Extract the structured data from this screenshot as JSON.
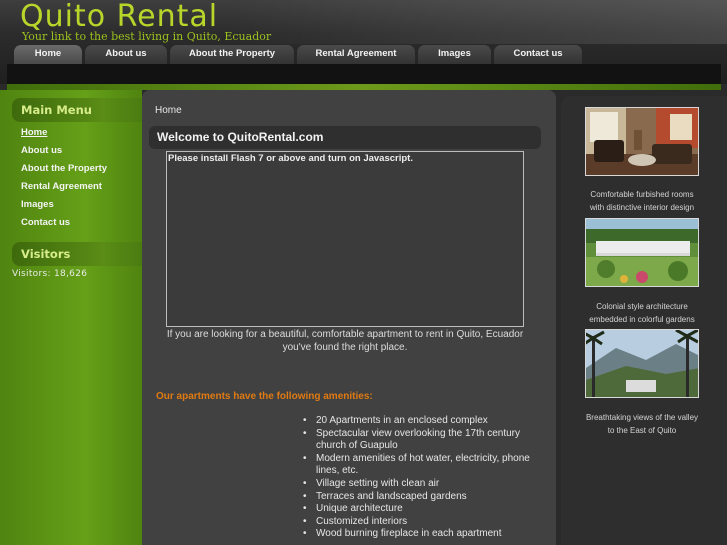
{
  "site": {
    "title": "Quito Rental",
    "tagline": "Your link to the best living in Quito, Ecuador"
  },
  "nav": {
    "tabs": [
      {
        "label": "Home",
        "active": true
      },
      {
        "label": "About us"
      },
      {
        "label": "About the Property"
      },
      {
        "label": "Rental Agreement"
      },
      {
        "label": "Images"
      },
      {
        "label": "Contact us"
      }
    ]
  },
  "sidebar": {
    "main_menu_heading": "Main Menu",
    "items": [
      {
        "label": "Home",
        "active": true
      },
      {
        "label": "About us"
      },
      {
        "label": "About the Property"
      },
      {
        "label": "Rental Agreement"
      },
      {
        "label": "Images"
      },
      {
        "label": "Contact us"
      }
    ],
    "visitors_heading": "Visitors",
    "visitors_text": "Visitors: 18,626"
  },
  "main": {
    "breadcrumb": "Home",
    "page_title": "Welcome to QuitoRental.com",
    "flash_message": "Please install Flash 7 or above and turn on Javascript.",
    "intro_line1": "If you are looking for a beautiful, comfortable apartment to rent in Quito, Ecuador",
    "intro_line2": "you've found the right place.",
    "amenities_heading": "Our apartments have the following amenities:",
    "amenities": [
      "20 Apartments in an enclosed complex",
      "Spectacular view overlooking the 17th century church of Guapulo",
      "Modern amenities of hot water, electricity, phone lines, etc.",
      "Village setting with clean air",
      "Terraces and landscaped gardens",
      "Unique architecture",
      "Customized interiors",
      "Wood burning fireplace in each apartment"
    ]
  },
  "gallery": [
    {
      "caption_line1": "Comfortable furbished rooms",
      "caption_line2": "with distinctive interior design"
    },
    {
      "caption_line1": "Colonial style architecture",
      "caption_line2": "embedded in colorful gardens"
    },
    {
      "caption_line1": "Breathtaking views of the valley",
      "caption_line2": "to the East of Quito"
    }
  ],
  "colors": {
    "brand_green": "#b8d62a",
    "sidebar_green": "#66a018",
    "amenities_heading": "#e07a12"
  }
}
